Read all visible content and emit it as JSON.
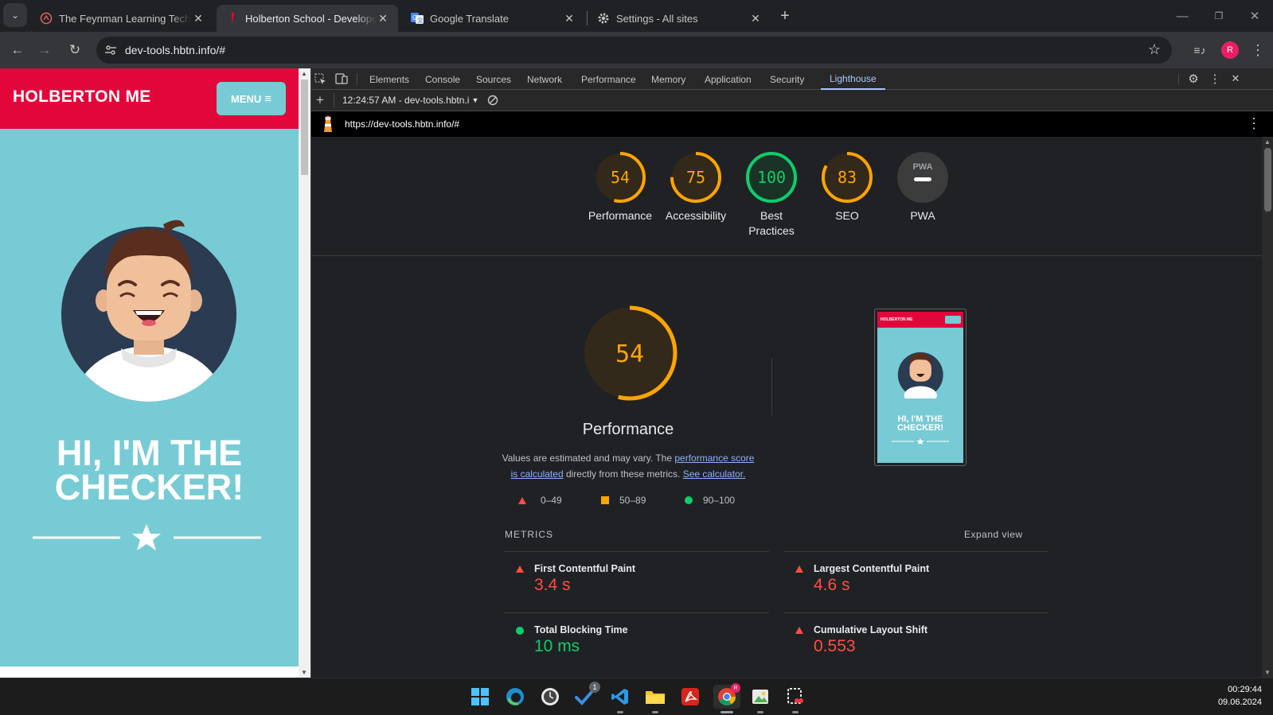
{
  "browser": {
    "tabs": [
      {
        "title": "The Feynman Learning Technique",
        "active": false,
        "favicon": "feynman-favicon"
      },
      {
        "title": "Holberton School - Developer tools",
        "active": true,
        "favicon": "holberton-favicon"
      },
      {
        "title": "Google Translate",
        "active": false,
        "favicon": "google-translate-favicon"
      },
      {
        "title": "Settings - All sites",
        "active": false,
        "favicon": "settings-gear-favicon"
      }
    ],
    "url": "dev-tools.hbtn.info/#",
    "profile_initial": "R"
  },
  "site": {
    "logo": "HOLBERTON ME",
    "menu_label": "MENU",
    "hero_title_line1": "HI, I'M THE",
    "hero_title_line2": "CHECKER!",
    "header_color": "#e3063b",
    "bg_color": "#77cbd4"
  },
  "devtools": {
    "tabs": [
      "Elements",
      "Console",
      "Sources",
      "Network",
      "Performance",
      "Memory",
      "Application",
      "Security",
      "Lighthouse"
    ],
    "active_tab": "Lighthouse",
    "report_selector": "12:24:57 AM - dev-tools.hbtn.i",
    "report_url": "https://dev-tools.hbtn.info/#"
  },
  "lighthouse": {
    "scores": [
      {
        "label": "Performance",
        "value": "54",
        "score": 54,
        "color": "#ffa400"
      },
      {
        "label": "Accessibility",
        "value": "75",
        "score": 75,
        "color": "#ffa400"
      },
      {
        "label": "Best Practices",
        "value": "100",
        "score": 100,
        "color": "#0cce6b"
      },
      {
        "label": "SEO",
        "value": "83",
        "score": 83,
        "color": "#ffa400"
      },
      {
        "label": "PWA",
        "value": "",
        "score": null,
        "color": "#9aa0a6"
      }
    ],
    "main_score": "54",
    "main_label": "Performance",
    "desc_part1": "Values are estimated and may vary. The",
    "desc_link1": "performance score is calculated",
    "desc_part2": "directly from these metrics.",
    "desc_link2": "See calculator.",
    "legend": [
      {
        "range": "0–49",
        "shape": "triangle",
        "color": "#ff4e42"
      },
      {
        "range": "50–89",
        "shape": "square",
        "color": "#ffa400"
      },
      {
        "range": "90–100",
        "shape": "circle",
        "color": "#0cce6b"
      }
    ],
    "metrics_title": "METRICS",
    "expand_label": "Expand view",
    "metrics": [
      {
        "name": "First Contentful Paint",
        "value": "3.4 s",
        "status": "fail",
        "color": "#ff4e42"
      },
      {
        "name": "Largest Contentful Paint",
        "value": "4.6 s",
        "status": "fail",
        "color": "#ff4e42"
      },
      {
        "name": "Total Blocking Time",
        "value": "10 ms",
        "status": "pass",
        "color": "#0cce6b"
      },
      {
        "name": "Cumulative Layout Shift",
        "value": "0.553",
        "status": "fail",
        "color": "#ff4e42"
      }
    ],
    "thumb_logo": "HOLBERTON ME",
    "thumb_title": "HI, I'M THE CHECKER!"
  },
  "taskbar": {
    "time": "00:29:44",
    "date": "09.06.2024",
    "badge": "1"
  }
}
